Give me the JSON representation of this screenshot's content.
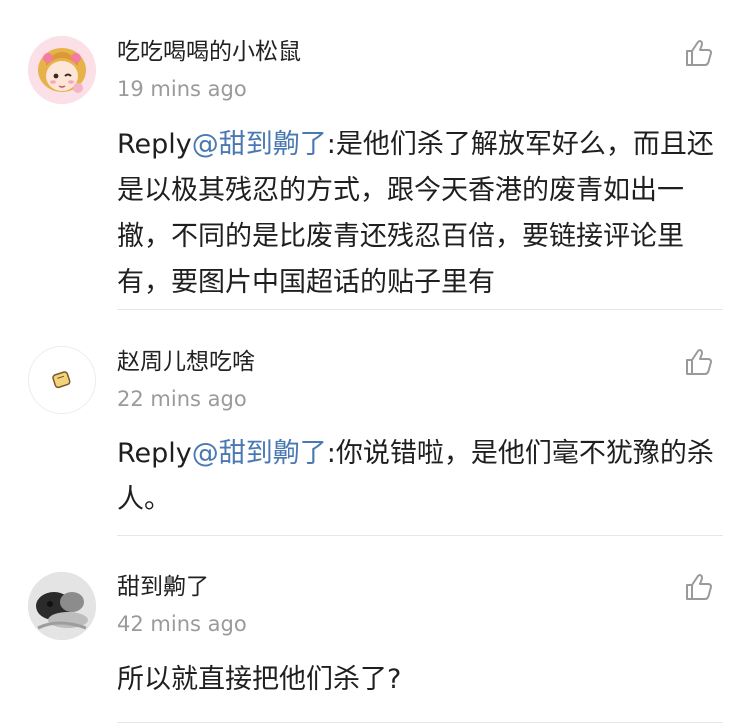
{
  "comments": [
    {
      "username": "吃吃喝喝的小松鼠",
      "time": "19 mins ago",
      "reply_prefix": "Reply",
      "mention": "@甜到齁了",
      "text": ":是他们杀了解放军好么，而且还是以极其残忍的方式，跟今天香港的废青如出一撤，不同的是比废青还残忍百倍，要链接评论里有，要图片中国超话的贴子里有",
      "avatar": "cartoon-girl-avatar"
    },
    {
      "username": "赵周儿想吃啥",
      "time": "22 mins ago",
      "reply_prefix": "Reply",
      "mention": "@甜到齁了",
      "text": ":你说错啦，是他们毫不犹豫的杀人。",
      "avatar": "toast-avatar"
    },
    {
      "username": "甜到齁了",
      "time": "42 mins ago",
      "reply_prefix": "",
      "mention": "",
      "text": "所以就直接把他们杀了?",
      "avatar": "photo-avatar"
    }
  ],
  "icons": {
    "like": "thumbs-up-icon"
  },
  "colors": {
    "mention": "#4a79b2",
    "timestamp": "#9a9a9a",
    "divider": "#e6e6e6"
  }
}
